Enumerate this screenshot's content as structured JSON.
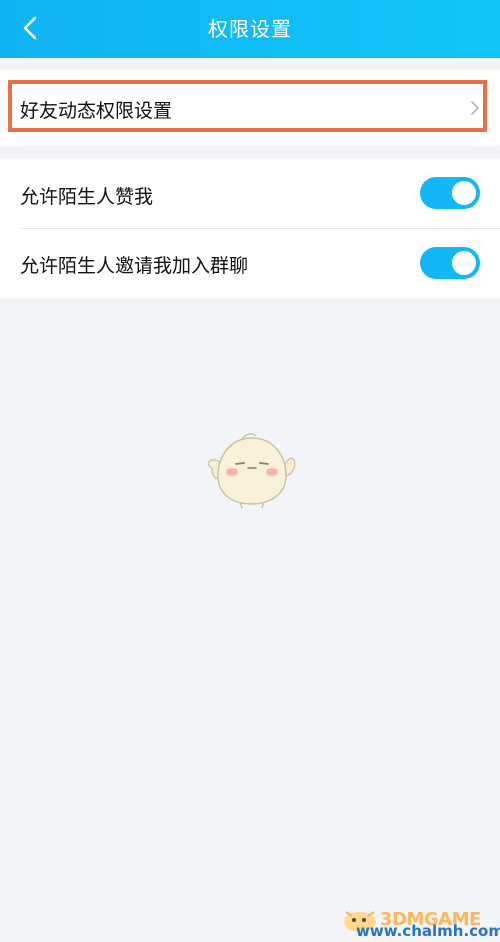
{
  "nav": {
    "title": "权限设置",
    "back_icon": "chevron-left-icon"
  },
  "settings": {
    "dynamic_permission": {
      "label": "好友动态权限设置",
      "icon": "chevron-right-icon"
    },
    "toggles": [
      {
        "label": "允许陌生人赞我",
        "on": true
      },
      {
        "label": "允许陌生人邀请我加入群聊",
        "on": true
      }
    ]
  },
  "watermark": {
    "brand": "3DMGAME",
    "url": "www.chalmh.com"
  },
  "colors": {
    "accent": "#12b7f5",
    "highlight_border": "#e8704a",
    "background": "#f3f4f8"
  }
}
